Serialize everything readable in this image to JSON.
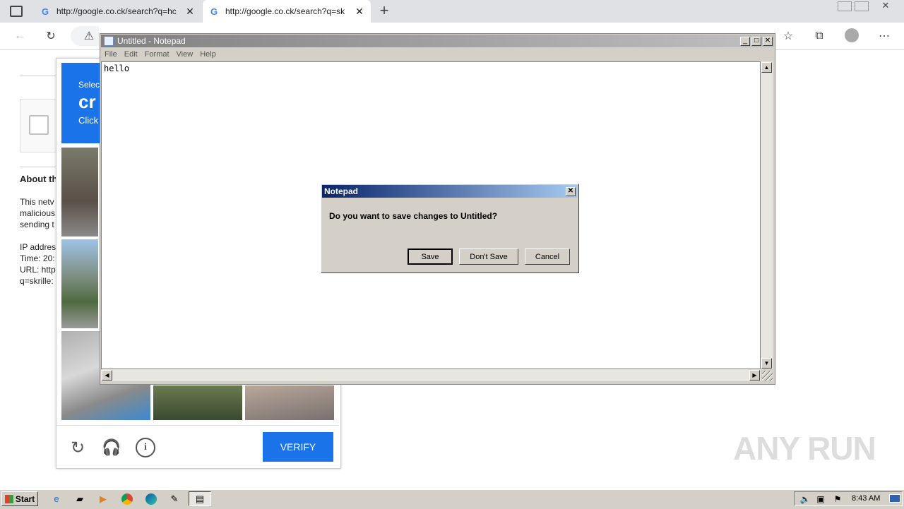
{
  "browser": {
    "tabs": [
      {
        "favicon": "G",
        "title": "http://google.co.ck/search?q=hc"
      },
      {
        "favicon": "G",
        "title": "http://google.co.ck/search?q=sk"
      }
    ],
    "close_glyph": "✕",
    "new_tab_glyph": "+"
  },
  "page": {
    "heading_partial": "About th",
    "lines_partial": [
      "This netv",
      "malicious",
      "sending t"
    ],
    "info_partial": [
      "IP addres",
      "Time: 20:",
      "URL: http",
      "q=skrille:"
    ]
  },
  "captcha": {
    "header_line1": "Selec",
    "header_line2": "cr",
    "header_line3": "Click",
    "verify_label": "VERIFY"
  },
  "notepad": {
    "title": "Untitled - Notepad",
    "menu": [
      "File",
      "Edit",
      "Format",
      "View",
      "Help"
    ],
    "content": "hello"
  },
  "dialog": {
    "title": "Notepad",
    "message": "Do you want to save changes to Untitled?",
    "buttons": {
      "save": "Save",
      "dont_save": "Don't Save",
      "cancel": "Cancel"
    }
  },
  "taskbar": {
    "start_label": "Start",
    "clock": "8:43 AM"
  },
  "watermark": "ANY RUN"
}
